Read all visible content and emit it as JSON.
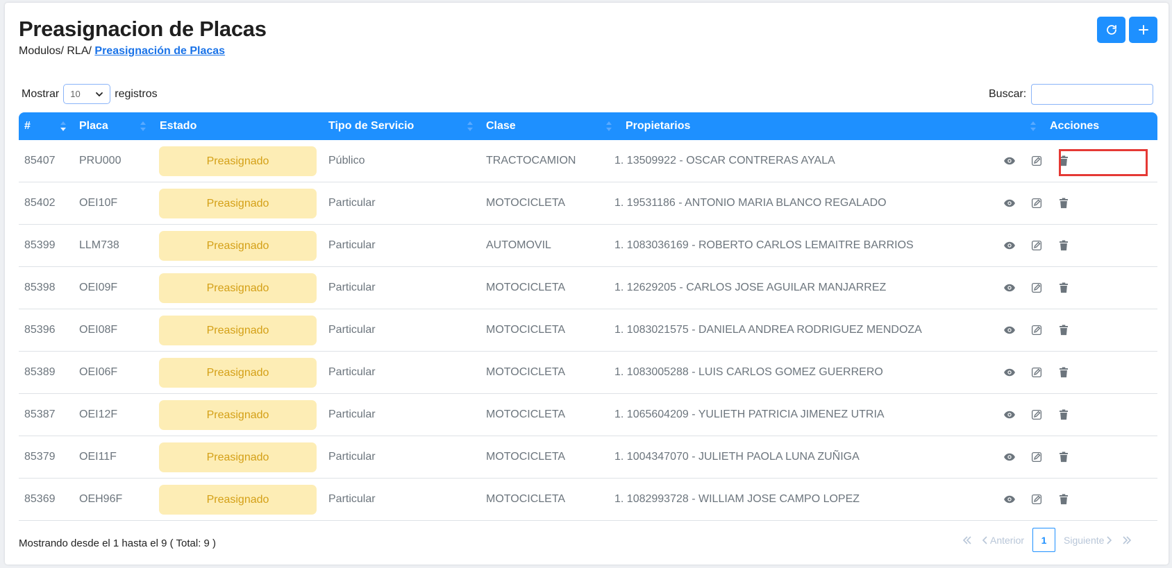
{
  "page": {
    "title": "Preasignacion de Placas",
    "breadcrumb": {
      "prefix": "Modulos/ RLA/ ",
      "current": "Preasignación de Placas"
    }
  },
  "toolbar": {
    "refresh_icon": "refresh-icon",
    "add_icon": "plus-icon"
  },
  "controls": {
    "show_label": "Mostrar",
    "page_length": "10",
    "records_label": "registros",
    "search_label": "Buscar:",
    "search_value": ""
  },
  "table": {
    "columns": [
      "#",
      "Placa",
      "Estado",
      "Tipo de Servicio",
      "Clase",
      "Propietarios",
      "Acciones"
    ],
    "rows": [
      {
        "id": "85407",
        "placa": "PRU000",
        "estado": "Preasignado",
        "servicio": "Público",
        "clase": "TRACTOCAMION",
        "propietario": "1. 13509922 - OSCAR CONTRERAS AYALA"
      },
      {
        "id": "85402",
        "placa": "OEI10F",
        "estado": "Preasignado",
        "servicio": "Particular",
        "clase": "MOTOCICLETA",
        "propietario": "1. 19531186 - ANTONIO MARIA BLANCO REGALADO"
      },
      {
        "id": "85399",
        "placa": "LLM738",
        "estado": "Preasignado",
        "servicio": "Particular",
        "clase": "AUTOMOVIL",
        "propietario": "1. 1083036169 - ROBERTO CARLOS LEMAITRE BARRIOS"
      },
      {
        "id": "85398",
        "placa": "OEI09F",
        "estado": "Preasignado",
        "servicio": "Particular",
        "clase": "MOTOCICLETA",
        "propietario": "1. 12629205 - CARLOS JOSE AGUILAR MANJARREZ"
      },
      {
        "id": "85396",
        "placa": "OEI08F",
        "estado": "Preasignado",
        "servicio": "Particular",
        "clase": "MOTOCICLETA",
        "propietario": "1. 1083021575 - DANIELA ANDREA RODRIGUEZ MENDOZA"
      },
      {
        "id": "85389",
        "placa": "OEI06F",
        "estado": "Preasignado",
        "servicio": "Particular",
        "clase": "MOTOCICLETA",
        "propietario": "1. 1083005288 - LUIS CARLOS GOMEZ GUERRERO"
      },
      {
        "id": "85387",
        "placa": "OEI12F",
        "estado": "Preasignado",
        "servicio": "Particular",
        "clase": "MOTOCICLETA",
        "propietario": "1. 1065604209 - YULIETH PATRICIA JIMENEZ UTRIA"
      },
      {
        "id": "85379",
        "placa": "OEI11F",
        "estado": "Preasignado",
        "servicio": "Particular",
        "clase": "MOTOCICLETA",
        "propietario": "1. 1004347070 - JULIETH PAOLA LUNA ZUÑIGA"
      },
      {
        "id": "85369",
        "placa": "OEH96F",
        "estado": "Preasignado",
        "servicio": "Particular",
        "clase": "MOTOCICLETA",
        "propietario": "1. 1082993728 - WILLIAM JOSE CAMPO LOPEZ"
      }
    ],
    "row_actions": [
      "eye-icon",
      "edit-icon",
      "trash-icon"
    ]
  },
  "footer": {
    "info": "Mostrando desde el 1 hasta el 9 ( Total: 9 )",
    "prev_label": "Anterior",
    "next_label": "Siguiente",
    "current_page": "1"
  },
  "colors": {
    "primary": "#1e90ff",
    "badge_bg": "#fdedb5",
    "badge_text": "#d4a017",
    "highlight": "#e53935",
    "icon": "#6c757d"
  }
}
